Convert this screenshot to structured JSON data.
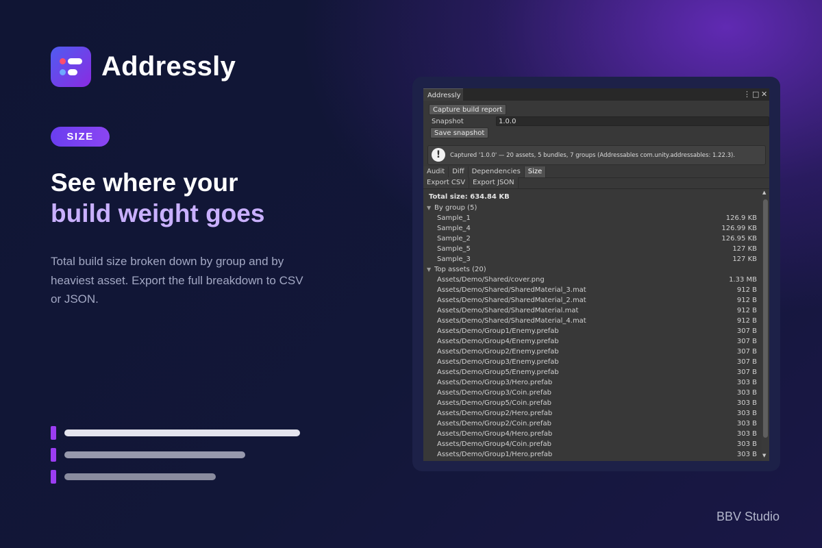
{
  "brand": {
    "name": "Addressly"
  },
  "tag": "SIZE",
  "headline": {
    "line1": "See where your",
    "line2": "build weight goes"
  },
  "description": "Total build size broken down by group and by heaviest asset. Export the full breakdown to CSV or JSON.",
  "footer": "BBV Studio",
  "colors": {
    "accent": "#8b45f2",
    "headline_highlight": "#c9b0ff",
    "background": "#101534"
  },
  "editor": {
    "tab_title": "Addressly",
    "window_icons": [
      "kebab-menu-icon",
      "maximize-icon",
      "close-icon"
    ],
    "capture_button": "Capture build report",
    "snapshot_label": "Snapshot",
    "snapshot_value": "1.0.0",
    "save_button": "Save snapshot",
    "info_message": "Captured '1.0.0' — 20 assets, 5 bundles, 7 groups (Addressables com.unity.addressables: 1.22.3).",
    "tabs": [
      {
        "label": "Audit",
        "active": false
      },
      {
        "label": "Diff",
        "active": false
      },
      {
        "label": "Dependencies",
        "active": false
      },
      {
        "label": "Size",
        "active": true
      }
    ],
    "export_buttons": [
      "Export CSV",
      "Export JSON"
    ],
    "total_size": "Total size: 634.84 KB",
    "by_group": {
      "header": "By group (5)",
      "items": [
        {
          "name": "Sample_1",
          "size": "126.9 KB"
        },
        {
          "name": "Sample_4",
          "size": "126.99 KB"
        },
        {
          "name": "Sample_2",
          "size": "126.95 KB"
        },
        {
          "name": "Sample_5",
          "size": "127 KB"
        },
        {
          "name": "Sample_3",
          "size": "127 KB"
        }
      ]
    },
    "top_assets": {
      "header": "Top assets (20)",
      "items": [
        {
          "name": "Assets/Demo/Shared/cover.png",
          "size": "1.33 MB"
        },
        {
          "name": "Assets/Demo/Shared/SharedMaterial_3.mat",
          "size": "912 B"
        },
        {
          "name": "Assets/Demo/Shared/SharedMaterial_2.mat",
          "size": "912 B"
        },
        {
          "name": "Assets/Demo/Shared/SharedMaterial.mat",
          "size": "912 B"
        },
        {
          "name": "Assets/Demo/Shared/SharedMaterial_4.mat",
          "size": "912 B"
        },
        {
          "name": "Assets/Demo/Group1/Enemy.prefab",
          "size": "307 B"
        },
        {
          "name": "Assets/Demo/Group4/Enemy.prefab",
          "size": "307 B"
        },
        {
          "name": "Assets/Demo/Group2/Enemy.prefab",
          "size": "307 B"
        },
        {
          "name": "Assets/Demo/Group3/Enemy.prefab",
          "size": "307 B"
        },
        {
          "name": "Assets/Demo/Group5/Enemy.prefab",
          "size": "307 B"
        },
        {
          "name": "Assets/Demo/Group3/Hero.prefab",
          "size": "303 B"
        },
        {
          "name": "Assets/Demo/Group3/Coin.prefab",
          "size": "303 B"
        },
        {
          "name": "Assets/Demo/Group5/Coin.prefab",
          "size": "303 B"
        },
        {
          "name": "Assets/Demo/Group2/Hero.prefab",
          "size": "303 B"
        },
        {
          "name": "Assets/Demo/Group2/Coin.prefab",
          "size": "303 B"
        },
        {
          "name": "Assets/Demo/Group4/Hero.prefab",
          "size": "303 B"
        },
        {
          "name": "Assets/Demo/Group4/Coin.prefab",
          "size": "303 B"
        },
        {
          "name": "Assets/Demo/Group1/Hero.prefab",
          "size": "303 B"
        }
      ]
    }
  }
}
